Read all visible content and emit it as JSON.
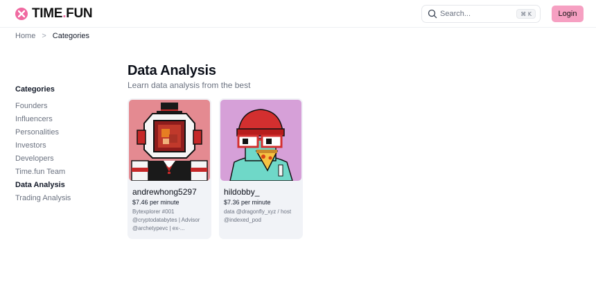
{
  "header": {
    "logo_text_1": "TIME",
    "logo_dot": ".",
    "logo_text_2": "FUN",
    "search_placeholder": "Search...",
    "search_shortcut": "⌘ K",
    "login_label": "Login"
  },
  "breadcrumb": {
    "home": "Home",
    "separator": ">",
    "current": "Categories"
  },
  "sidebar": {
    "title": "Categories",
    "items": [
      {
        "label": "Founders"
      },
      {
        "label": "Influencers"
      },
      {
        "label": "Personalities"
      },
      {
        "label": "Investors"
      },
      {
        "label": "Developers"
      },
      {
        "label": "Time.fun Team"
      },
      {
        "label": "Data Analysis"
      },
      {
        "label": "Trading Analysis"
      }
    ]
  },
  "main": {
    "title": "Data Analysis",
    "subtitle": "Learn data analysis from the best"
  },
  "cards": [
    {
      "name": "andrewhong5297",
      "price": "$7.46 per minute",
      "bio": "Bytexplorer #001 @cryptodatabytes | Advisor @archetypevc | ex-..."
    },
    {
      "name": "hildobby_",
      "price": "$7.36 per minute",
      "bio": "data @dragonfly_xyz / host @indexed_pod"
    }
  ],
  "colors": {
    "accent_pink": "#f06aa1",
    "login_bg": "#f6a0c2",
    "card_bg": "#f1f3f7",
    "avatar1_bg": "#e48a91",
    "avatar2_bg": "#d6a0d8"
  },
  "icons": {
    "logo": "hourglass-logo-icon",
    "search": "search-icon",
    "breadcrumb_separator": "chevron-right-icon"
  }
}
